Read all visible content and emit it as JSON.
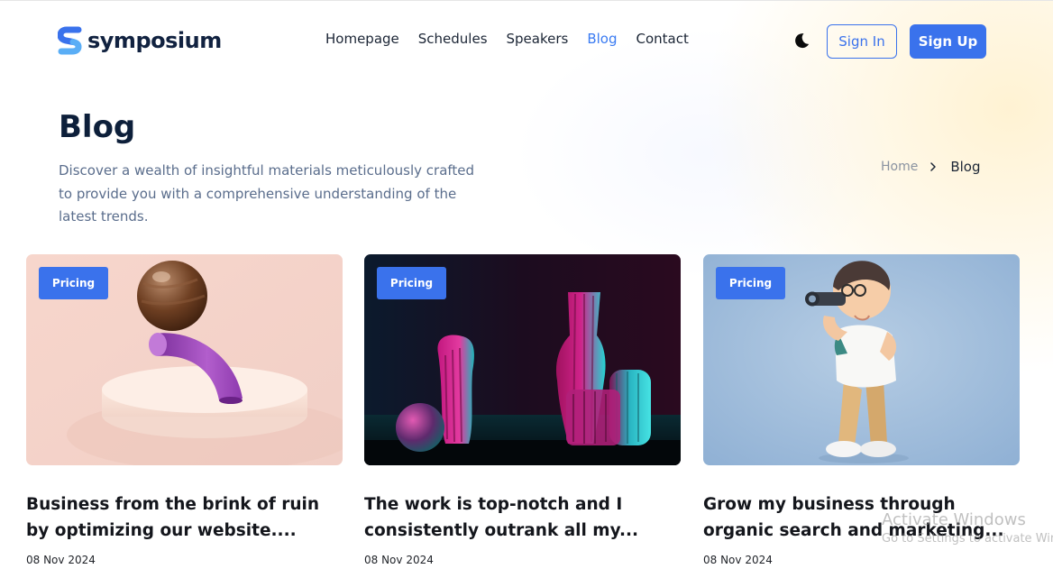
{
  "brand": {
    "name": "symposium",
    "accent": "#3a72ec"
  },
  "nav": {
    "items": [
      {
        "label": "Homepage",
        "active": false
      },
      {
        "label": "Schedules",
        "active": false
      },
      {
        "label": "Speakers",
        "active": false
      },
      {
        "label": "Blog",
        "active": true
      },
      {
        "label": "Contact",
        "active": false
      }
    ]
  },
  "header": {
    "theme_icon": "moon-icon",
    "signin_label": "Sign In",
    "signup_label": "Sign Up"
  },
  "hero": {
    "title": "Blog",
    "description": "Discover a wealth of insightful materials meticulously crafted to provide you with a comprehensive understanding of the latest trends."
  },
  "breadcrumb": {
    "home": "Home",
    "separator_icon": "chevron-right-icon",
    "current": "Blog"
  },
  "posts": [
    {
      "tag": "Pricing",
      "title": "Business from the brink of ruin by optimizing our website....",
      "date": "08 Nov 2024",
      "image": "purple-arch-sphere-illustration"
    },
    {
      "tag": "Pricing",
      "title": "The work is top-notch and I consistently outrank all my...",
      "date": "08 Nov 2024",
      "image": "neon-vases-illustration"
    },
    {
      "tag": "Pricing",
      "title": "Grow my business through organic search and marketing...",
      "date": "08 Nov 2024",
      "image": "boy-with-binoculars-illustration"
    }
  ],
  "watermark": {
    "title": "Activate Windows",
    "subtitle": "Go to Settings to activate Windows."
  }
}
